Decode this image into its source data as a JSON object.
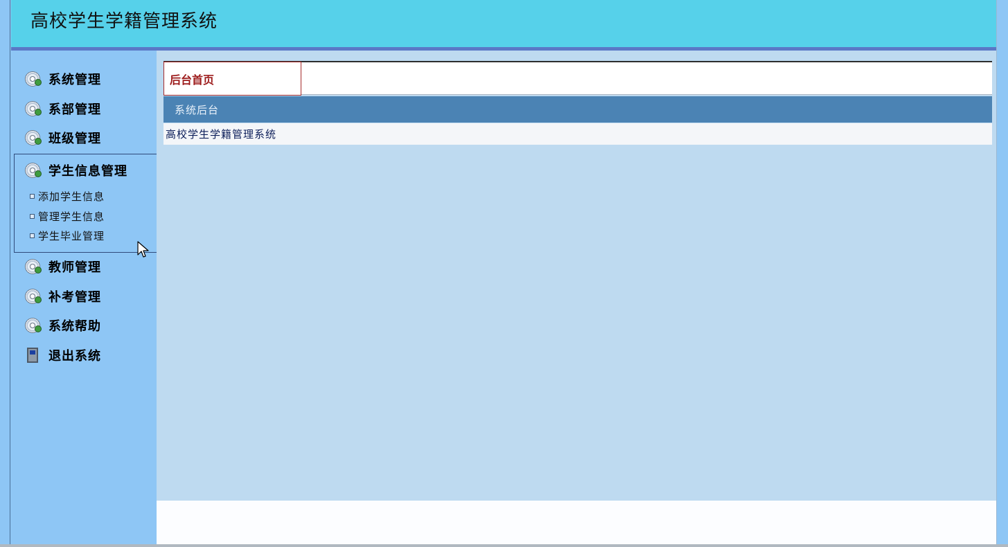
{
  "header": {
    "title": "高校学生学籍管理系统"
  },
  "sidebar": {
    "items": [
      {
        "label": "系统管理",
        "icon": "cd-icon"
      },
      {
        "label": "系部管理",
        "icon": "cd-icon"
      },
      {
        "label": "班级管理",
        "icon": "cd-icon"
      },
      {
        "label": "学生信息管理",
        "icon": "cd-icon",
        "expanded": true,
        "subitems": [
          {
            "label": "添加学生信息"
          },
          {
            "label": "管理学生信息"
          },
          {
            "label": "学生毕业管理"
          }
        ]
      },
      {
        "label": "教师管理",
        "icon": "cd-icon"
      },
      {
        "label": "补考管理",
        "icon": "cd-icon"
      },
      {
        "label": "系统帮助",
        "icon": "cd-icon"
      },
      {
        "label": "退出系统",
        "icon": "door-icon"
      }
    ]
  },
  "main": {
    "tab": {
      "label": "后台首页"
    },
    "panel": {
      "header": "系统后台",
      "body": "高校学生学籍管理系统"
    }
  },
  "colors": {
    "header_bg": "#56d1ea",
    "header_bar": "#5a78c6",
    "sidebar_bg": "#8ec6f5",
    "main_bg": "#bedaf0",
    "panel_header_bg": "#4b83b4",
    "tab_text": "#9c1a1a"
  }
}
